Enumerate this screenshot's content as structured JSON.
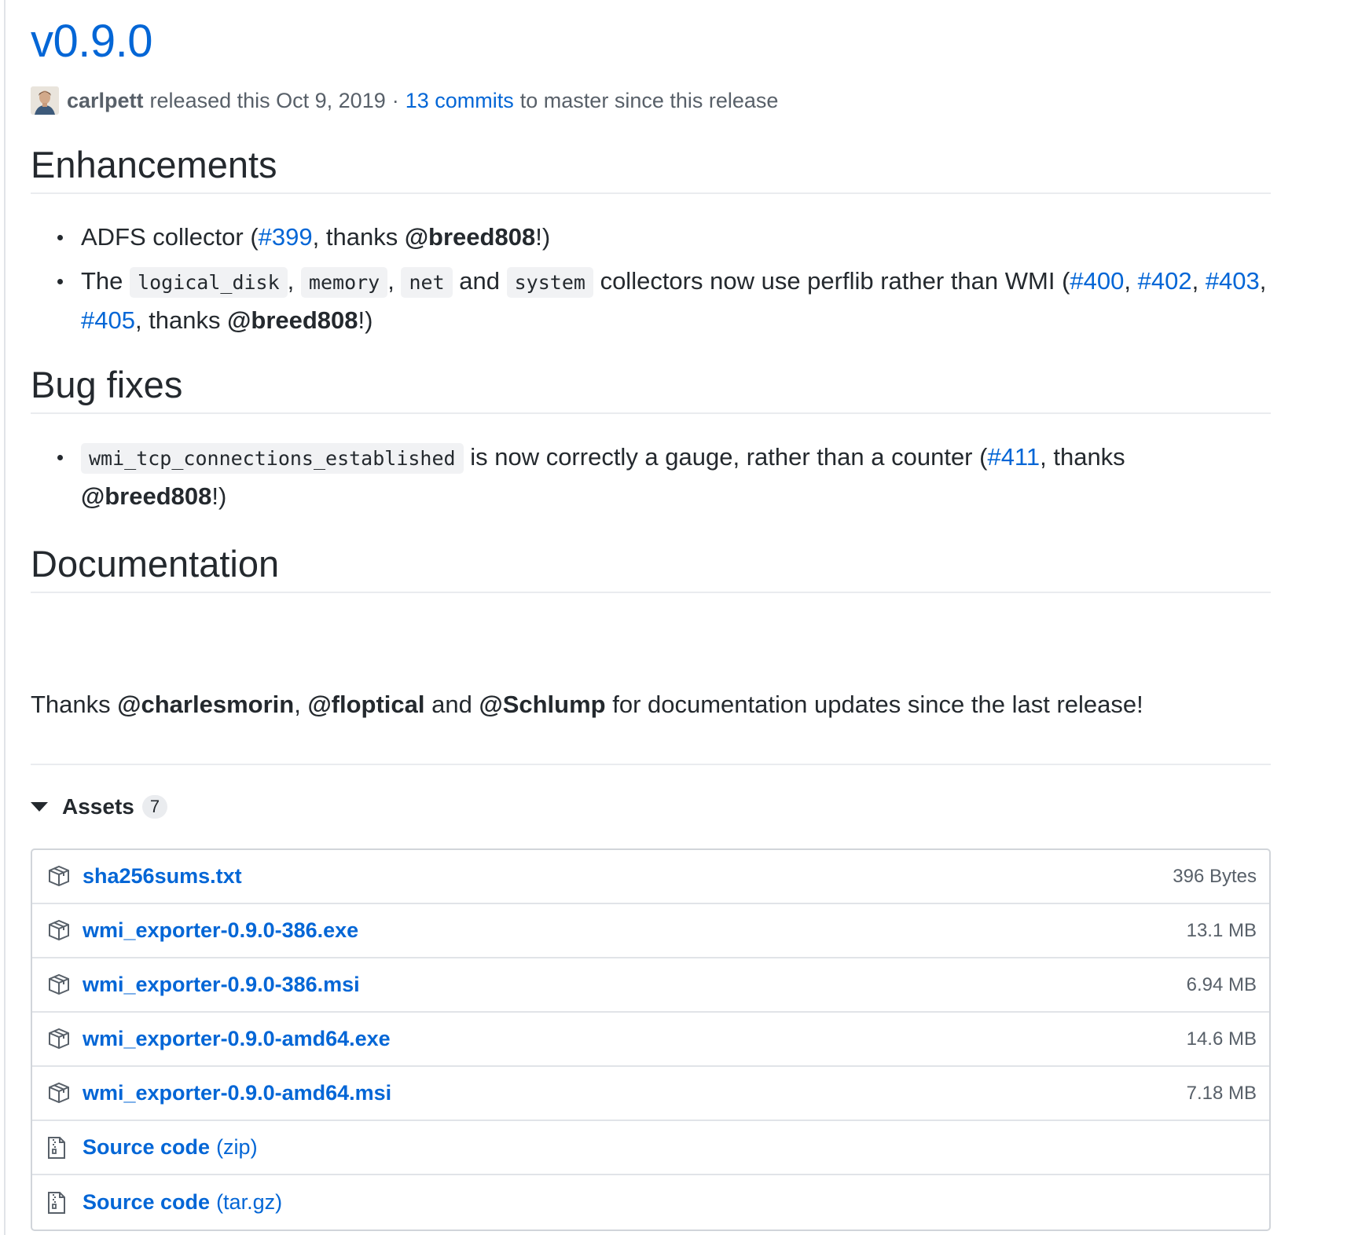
{
  "release": {
    "title": "v0.9.0",
    "author": "carlpett",
    "released_text": "released this Oct 9, 2019",
    "separator": "·",
    "commits_link": "13 commits",
    "commits_suffix": "to master since this release"
  },
  "sections": {
    "enhancements_title": "Enhancements",
    "bugfixes_title": "Bug fixes",
    "documentation_title": "Documentation"
  },
  "enhancements": {
    "item1": {
      "prefix": "ADFS collector (",
      "link": "#399",
      "mid": ", thanks ",
      "mention": "@breed808",
      "suffix": "!)"
    },
    "item2": {
      "the": "The",
      "code1": "logical_disk",
      "comma1": ",",
      "code2": "memory",
      "comma2": ",",
      "code3": "net",
      "and": "and",
      "code4": "system",
      "text": "collectors now use perflib rather than WMI (",
      "link1": "#400",
      "link2": "#402",
      "link3": "#403",
      "link4": "#405",
      "mid": ", thanks ",
      "mention": "@breed808",
      "suffix": "!)"
    }
  },
  "bugfixes": {
    "item1": {
      "code": "wmi_tcp_connections_established",
      "text": " is now correctly a gauge, rather than a counter (",
      "link": "#411",
      "mid": ", thanks",
      "mention": "@breed808",
      "suffix": "!)"
    }
  },
  "documentation": {
    "prefix": "Thanks ",
    "mention1": "@charlesmorin",
    "comma": ", ",
    "mention2": "@floptical",
    "and": " and ",
    "mention3": "@Schlump",
    "suffix": " for documentation updates since the last release!"
  },
  "assets": {
    "label": "Assets",
    "count": "7",
    "items": [
      {
        "name": "sha256sums.txt",
        "size": "396 Bytes",
        "icon": "package-icon"
      },
      {
        "name": "wmi_exporter-0.9.0-386.exe",
        "size": "13.1 MB",
        "icon": "package-icon"
      },
      {
        "name": "wmi_exporter-0.9.0-386.msi",
        "size": "6.94 MB",
        "icon": "package-icon"
      },
      {
        "name": "wmi_exporter-0.9.0-amd64.exe",
        "size": "14.6 MB",
        "icon": "package-icon"
      },
      {
        "name": "wmi_exporter-0.9.0-amd64.msi",
        "size": "7.18 MB",
        "icon": "package-icon"
      },
      {
        "name": "Source code",
        "type": "(zip)",
        "icon": "file-zip-icon"
      },
      {
        "name": "Source code",
        "type": "(tar.gz)",
        "icon": "file-zip-icon"
      }
    ]
  },
  "colors": {
    "link": "#0366d6",
    "text": "#24292e",
    "muted": "#586069",
    "code_bg": "#f1f2f4",
    "border": "#d1d5da"
  }
}
